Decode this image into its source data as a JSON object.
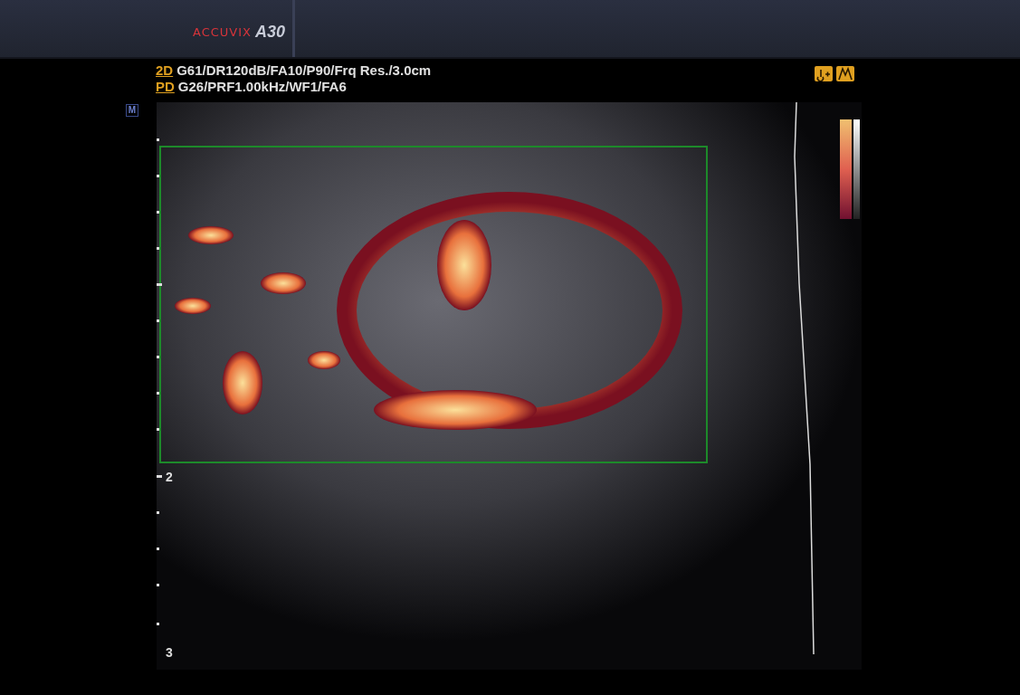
{
  "header": {
    "brand": "ACCUVIX",
    "model": "A30"
  },
  "parameters": [
    {
      "mode": "2D",
      "settings": "G61/DR120dB/FA10/P90/Frq Res./3.0cm"
    },
    {
      "mode": "PD",
      "settings": "G26/PRF1.00kHz/WF1/FA6"
    }
  ],
  "marker": "M",
  "depth_labels": [
    "2",
    "3"
  ]
}
